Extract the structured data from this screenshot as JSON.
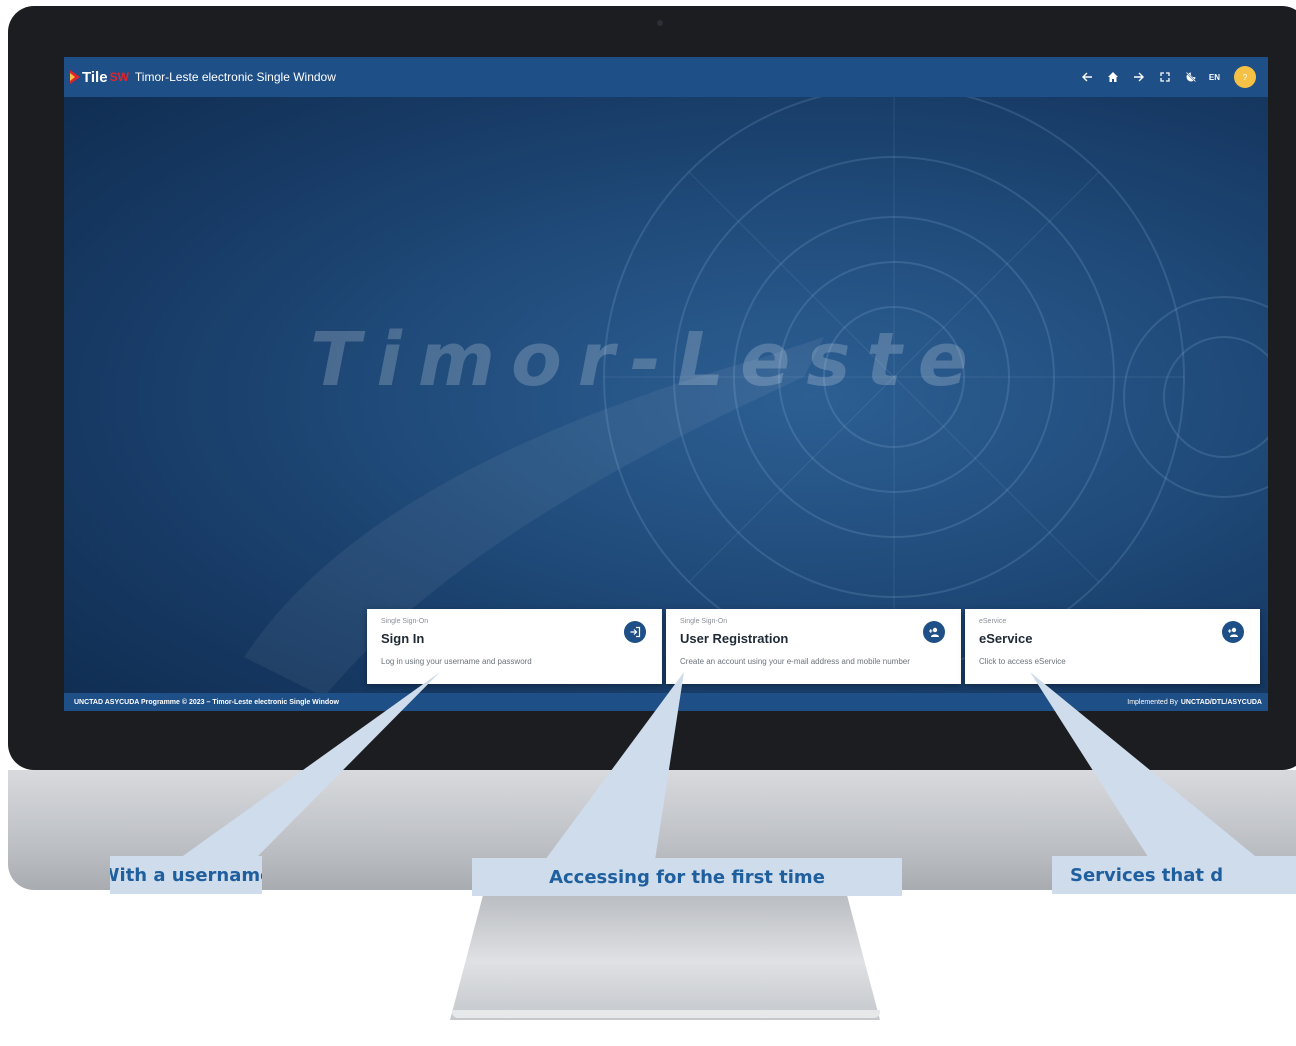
{
  "app": {
    "logo_text": "Tile",
    "logo_sw": "SW",
    "title": "Timor-Leste electronic Single Window"
  },
  "topbar": {
    "lang_label": "EN",
    "avatar_label": "?",
    "icons": [
      "arrow-left-icon",
      "home-icon",
      "arrow-right-icon",
      "fullscreen-icon",
      "dark-mode-off-icon"
    ]
  },
  "hero": {
    "watermark": "Timor-Leste"
  },
  "cards": [
    {
      "kicker": "Single Sign-On",
      "title": "Sign In",
      "description": "Log in using your username and password",
      "icon": "login-icon"
    },
    {
      "kicker": "Single Sign-On",
      "title": "User Registration",
      "description": "Create an account using your e-mail address and mobile number",
      "icon": "add-user-icon"
    },
    {
      "kicker": "eService",
      "title": "eService",
      "description": "Click to access eService",
      "icon": "add-user-icon"
    }
  ],
  "footer": {
    "left": "UNCTAD ASYCUDA Programme © 2023 – Timor-Leste electronic Single Window",
    "right_prefix": "Implemented By",
    "right_org": "UNCTAD/DTL/ASYCUDA"
  },
  "callouts": [
    "With a username",
    "Accessing for the first time",
    "Services that d"
  ],
  "colors": {
    "primary": "#1e4f86",
    "screen_bg": "#163963",
    "accent_red": "#e2232b",
    "avatar": "#f4c146",
    "callout_bg": "#cfdcec",
    "callout_text": "#1f5f9e"
  }
}
